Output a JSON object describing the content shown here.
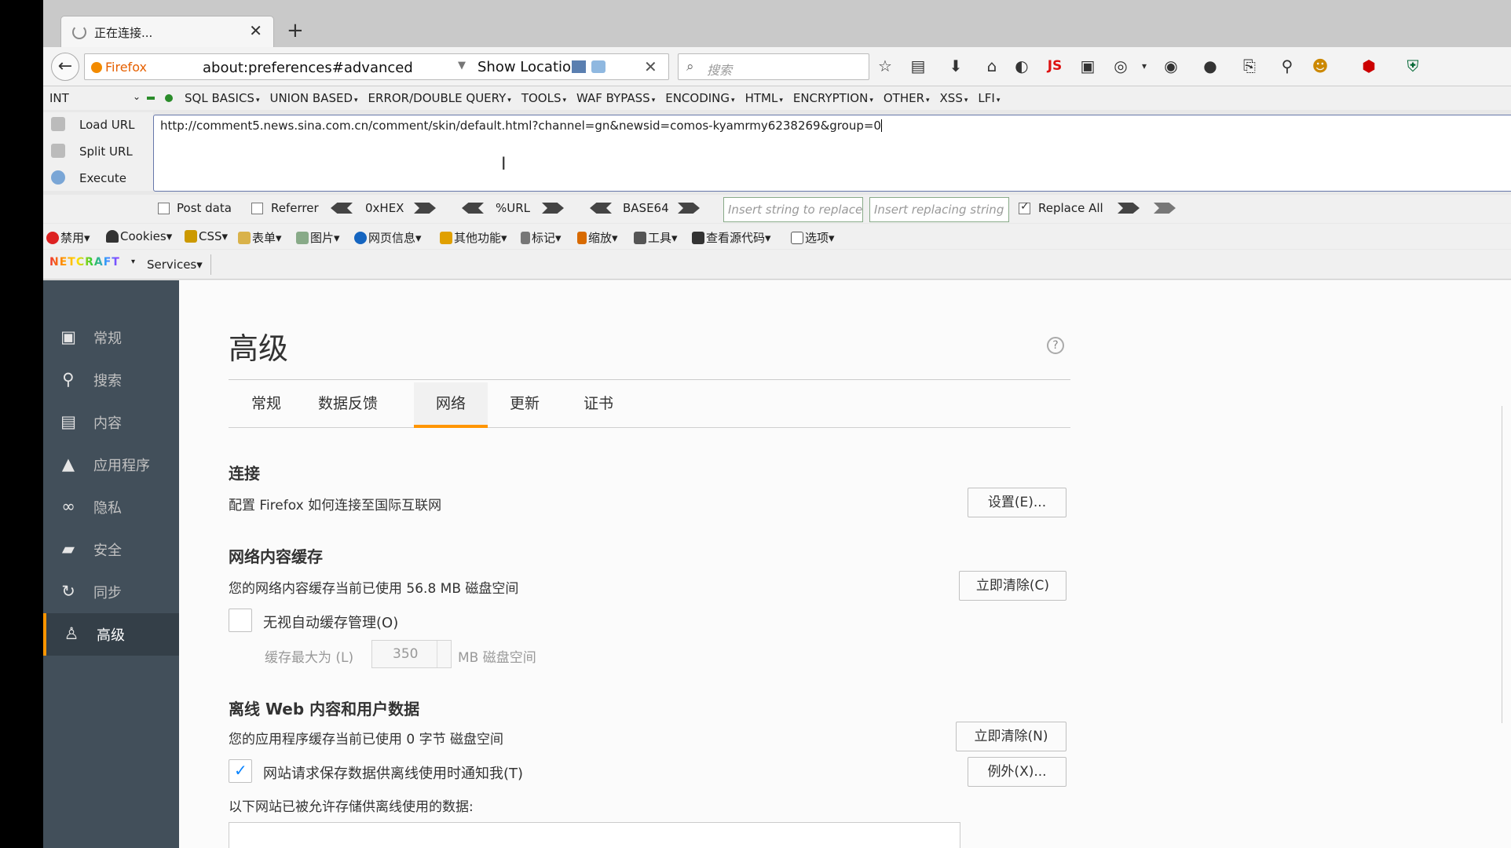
{
  "tab": {
    "title": "正在连接..."
  },
  "navbar": {
    "identity": "Firefox",
    "url": "about:preferences#advanced",
    "show_location": "Show Location",
    "search_placeholder": "搜索",
    "js_label": "JS"
  },
  "hackbar": {
    "select_value": "INT",
    "menus": [
      "SQL BASICS",
      "UNION BASED",
      "ERROR/DOUBLE QUERY",
      "TOOLS",
      "WAF BYPASS",
      "ENCODING",
      "HTML",
      "ENCRYPTION",
      "OTHER",
      "XSS",
      "LFI"
    ],
    "load_url": "Load URL",
    "split_url": "Split URL",
    "execute": "Execute",
    "url_value": "http://comment5.news.sina.com.cn/comment/skin/default.html?channel=gn&newsid=comos-kyamrmy6238269&group=0",
    "post_data": "Post data",
    "referrer": "Referrer",
    "hex": "0xHEX",
    "urlenc": "%URL",
    "base64": "BASE64",
    "insert_string_ph": "Insert string to replace",
    "insert_replacing_ph": "Insert replacing string",
    "replace_all": "Replace All"
  },
  "webdev": {
    "items": [
      "禁用",
      "Cookies",
      "CSS",
      "表单",
      "图片",
      "网页信息",
      "其他功能",
      "标记",
      "缩放",
      "工具",
      "查看源代码",
      "选项"
    ]
  },
  "netcraft": {
    "logo": "NETCRAFT",
    "services": "Services"
  },
  "sidebar": {
    "items": [
      {
        "label": "常规",
        "icon": "general-icon"
      },
      {
        "label": "搜索",
        "icon": "search-icon"
      },
      {
        "label": "内容",
        "icon": "content-icon"
      },
      {
        "label": "应用程序",
        "icon": "applications-icon"
      },
      {
        "label": "隐私",
        "icon": "privacy-mask-icon"
      },
      {
        "label": "安全",
        "icon": "security-lock-icon"
      },
      {
        "label": "同步",
        "icon": "sync-icon"
      },
      {
        "label": "高级",
        "icon": "advanced-wizard-icon"
      }
    ],
    "active_index": 7
  },
  "main": {
    "title": "高级",
    "tabs": [
      "常规",
      "数据反馈",
      "网络",
      "更新",
      "证书"
    ],
    "selected_tab": "网络",
    "connection": {
      "heading": "连接",
      "desc": "配置 Firefox 如何连接至国际互联网",
      "button": "设置(E)..."
    },
    "cache": {
      "heading": "网络内容缓存",
      "desc": "您的网络内容缓存当前已使用 56.8 MB 磁盘空间",
      "button": "立即清除(C)",
      "override_label": "无视自动缓存管理(O)",
      "override_checked": false,
      "limit_prefix": "缓存最大为 (L)",
      "limit_value": "350",
      "limit_suffix": "MB 磁盘空间"
    },
    "offline": {
      "heading": "离线 Web 内容和用户数据",
      "desc": "您的应用程序缓存当前已使用 0 字节 磁盘空间",
      "button": "立即清除(N)",
      "notify_label": "网站请求保存数据供离线使用时通知我(T)",
      "notify_checked": true,
      "exceptions_button": "例外(X)...",
      "allowed_label": "以下网站已被允许存储供离线使用的数据:"
    }
  },
  "colors": {
    "accent": "#ff9500",
    "sidebar_bg": "#424f5a",
    "sidebar_active_bg": "#343f48"
  }
}
